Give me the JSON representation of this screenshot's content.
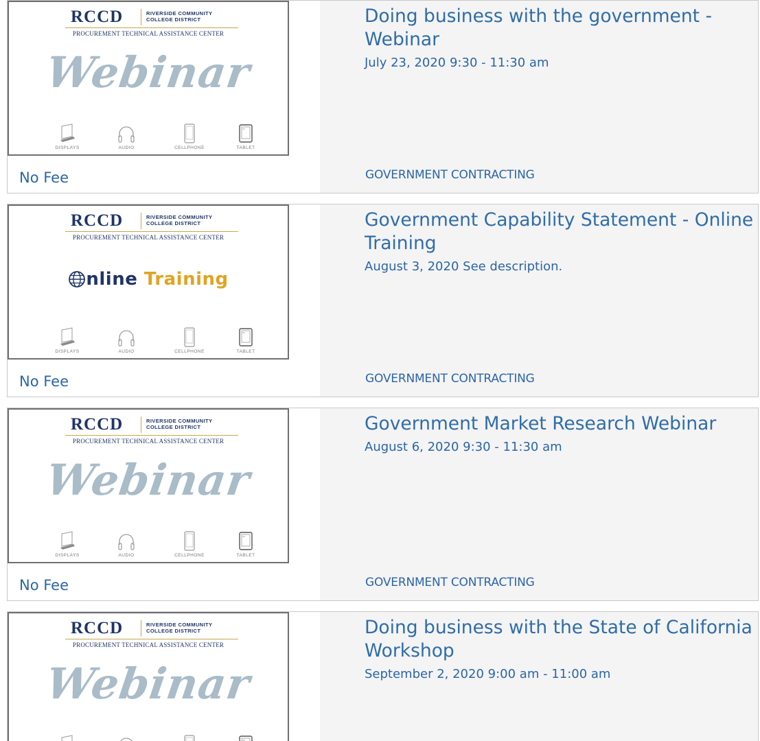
{
  "logo": {
    "abbr": "RCCD",
    "district": "RIVERSIDE COMMUNITY\nCOLLEGE DISTRICT",
    "subtitle": "PROCUREMENT TECHNICAL ASSISTANCE CENTER"
  },
  "banner_words": {
    "webinar": "Webinar",
    "online_a": "nline",
    "online_b": "Training"
  },
  "devices": [
    "DISPLAYS",
    "AUDIO",
    "CELLPHONE",
    "TABLET"
  ],
  "events": [
    {
      "title": "Doing business with the government - Webinar",
      "date": "July 23, 2020 9:30 - 11:30 am",
      "fee": "No Fee",
      "category": "GOVERNMENT CONTRACTING",
      "banner": "webinar"
    },
    {
      "title": "Government Capability Statement - Online Training",
      "date": "August 3, 2020 See description.",
      "fee": "No Fee",
      "category": "GOVERNMENT CONTRACTING",
      "banner": "online"
    },
    {
      "title": "Government Market Research Webinar",
      "date": "August 6, 2020 9:30 - 11:30 am",
      "fee": "No Fee",
      "category": "GOVERNMENT CONTRACTING",
      "banner": "webinar"
    },
    {
      "title": "Doing business with the State of California Workshop",
      "date": "September 2, 2020 9:00 am - 11:00 am",
      "fee": "",
      "category": "",
      "banner": "webinar"
    }
  ],
  "colors": {
    "link": "#2f6da9",
    "logo_navy": "#1f3566",
    "logo_gold": "#c9a64a",
    "webinar_gray": "#a9bcc8",
    "training_orange": "#e0a424",
    "panel_bg": "#f4f4f4"
  }
}
